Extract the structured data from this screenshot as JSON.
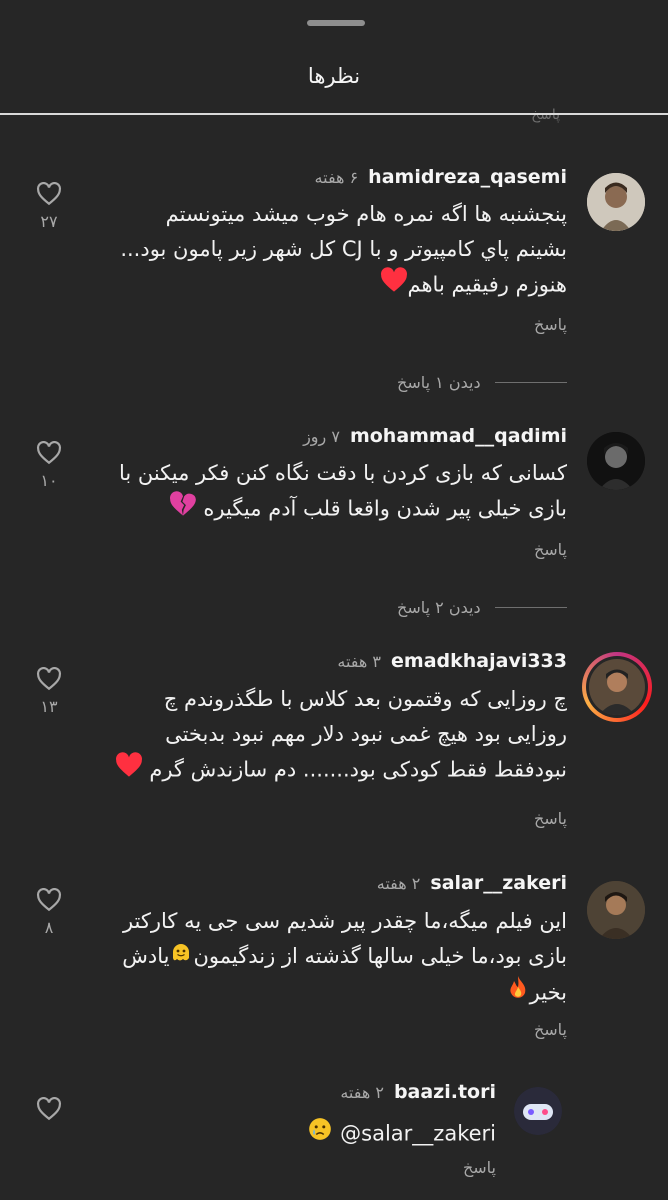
{
  "header": {
    "title": "نظرها",
    "ghost_reply": "پاسخ"
  },
  "comments": [
    {
      "username": "hamidreza_qasemi",
      "time": "۶ هفته",
      "lines": [
        "پنجشنبه ها اگه نمره هام خوب میشد میتونستم",
        "بشینم پاي کامپیوتر و با CJ کل شهر زیر پامون بود...",
        "هنوزم رفیقیم باهم"
      ],
      "reply": "پاسخ",
      "likes": "۲۷",
      "view_replies": "دیدن ۱ پاسخ",
      "emoji": "heart-red-emoji"
    },
    {
      "username": "mohammad__qadimi",
      "time": "۷ روز",
      "lines": [
        "کسانی که بازی کردن با دقت نگاه کنن فکر میکنن با",
        "بازی خیلی پیر شدن واقعا قلب آدم میگیره"
      ],
      "reply": "پاسخ",
      "likes": "۱۰",
      "view_replies": "دیدن ۲ پاسخ",
      "emoji": "broken-heart-emoji"
    },
    {
      "username": "emadkhajavi333",
      "time": "۳ هفته",
      "lines": [
        "چ روزایی که وقتمون بعد کلاس با طگذروندم چ",
        "روزایی بود هیچ غمی نبود دلار مهم نبود بدبختی",
        "نبودفقط فقط کودکی بود....... دم سازندش گرم"
      ],
      "reply": "پاسخ",
      "likes": "۱۳",
      "emoji": "heart-red-emoji"
    },
    {
      "username": "salar__zakeri",
      "time": "۲ هفته",
      "lines": [
        "این فیلم میگه،ما چقدر پیر شدیم سی جی یه کارکتر",
        "بازی بود،ما خیلی سالها گذشته از زندگیمون",
        "بخیر"
      ],
      "line2_tail": "یادش",
      "reply": "پاسخ",
      "likes": "۸",
      "emoji": "fire-emoji"
    },
    {
      "username": "baazi.tori",
      "time": "۲ هفته",
      "mention": "@salar__zakeri",
      "reply": "پاسخ",
      "emoji": "crying-face-emoji"
    }
  ],
  "colors": {
    "background": "#262626",
    "text": "#f2f2f2",
    "muted": "#a8a8a8",
    "heart": "#ff3040"
  }
}
